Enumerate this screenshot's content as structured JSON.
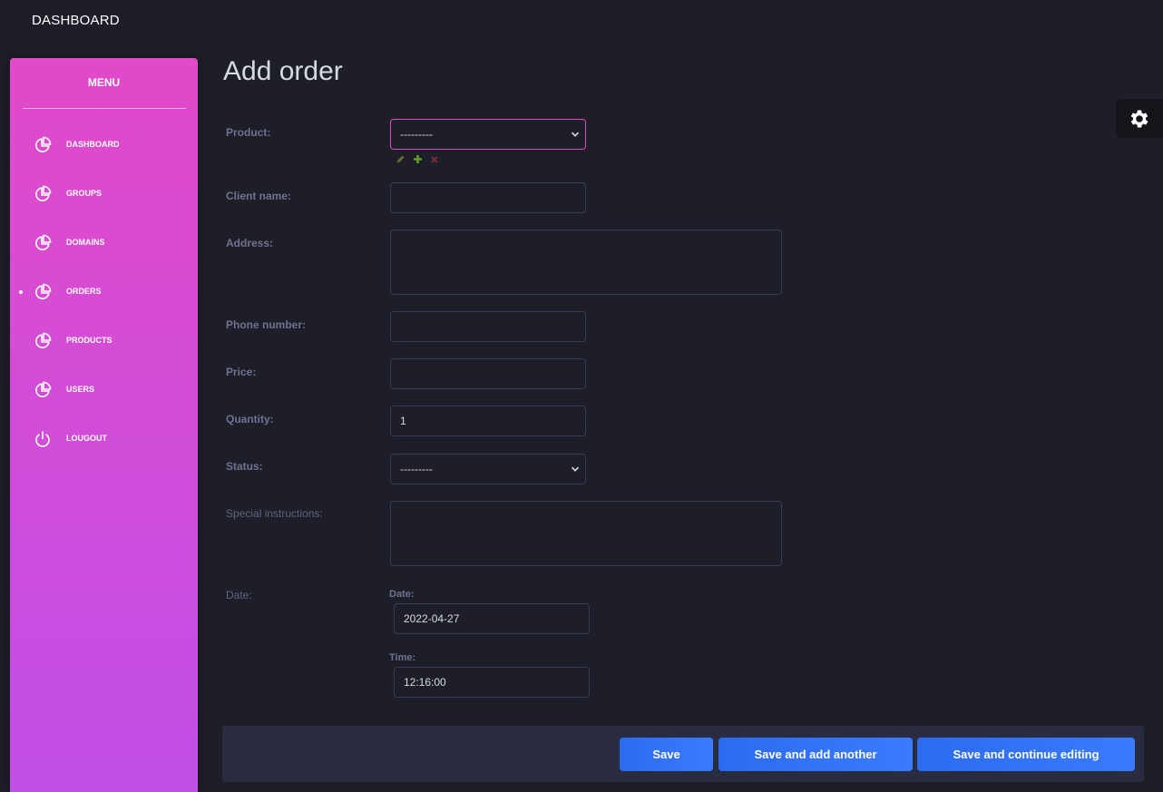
{
  "header": {
    "brand": "DASHBOARD"
  },
  "sidebar": {
    "title": "MENU",
    "items": [
      {
        "label": "DASHBOARD",
        "icon": "pie-chart-icon",
        "active": false
      },
      {
        "label": "GROUPS",
        "icon": "pie-chart-icon",
        "active": false
      },
      {
        "label": "DOMAINS",
        "icon": "pie-chart-icon",
        "active": false
      },
      {
        "label": "ORDERS",
        "icon": "pie-chart-icon",
        "active": true
      },
      {
        "label": "PRODUCTS",
        "icon": "pie-chart-icon",
        "active": false
      },
      {
        "label": "USERS",
        "icon": "pie-chart-icon",
        "active": false
      },
      {
        "label": "LOUGOUT",
        "icon": "power-icon",
        "active": false
      }
    ]
  },
  "page": {
    "title": "Add order"
  },
  "form": {
    "product": {
      "label": "Product:",
      "value": "---------"
    },
    "client_name": {
      "label": "Client name:",
      "value": ""
    },
    "address": {
      "label": "Address:",
      "value": ""
    },
    "phone": {
      "label": "Phone number:",
      "value": ""
    },
    "price": {
      "label": "Price:",
      "value": ""
    },
    "quantity": {
      "label": "Quantity:",
      "value": "1"
    },
    "status": {
      "label": "Status:",
      "value": "---------"
    },
    "special": {
      "label": "Special instructions:",
      "value": ""
    },
    "date": {
      "label": "Date:",
      "date_label": "Date:",
      "date_value": "2022-04-27",
      "time_label": "Time:",
      "time_value": "12:16:00"
    }
  },
  "actions": {
    "save": "Save",
    "save_add": "Save and add another",
    "save_continue": "Save and continue editing"
  },
  "colors": {
    "accent": "#e14ac9",
    "button": "#2c6bf0",
    "background": "#1e1e28"
  }
}
